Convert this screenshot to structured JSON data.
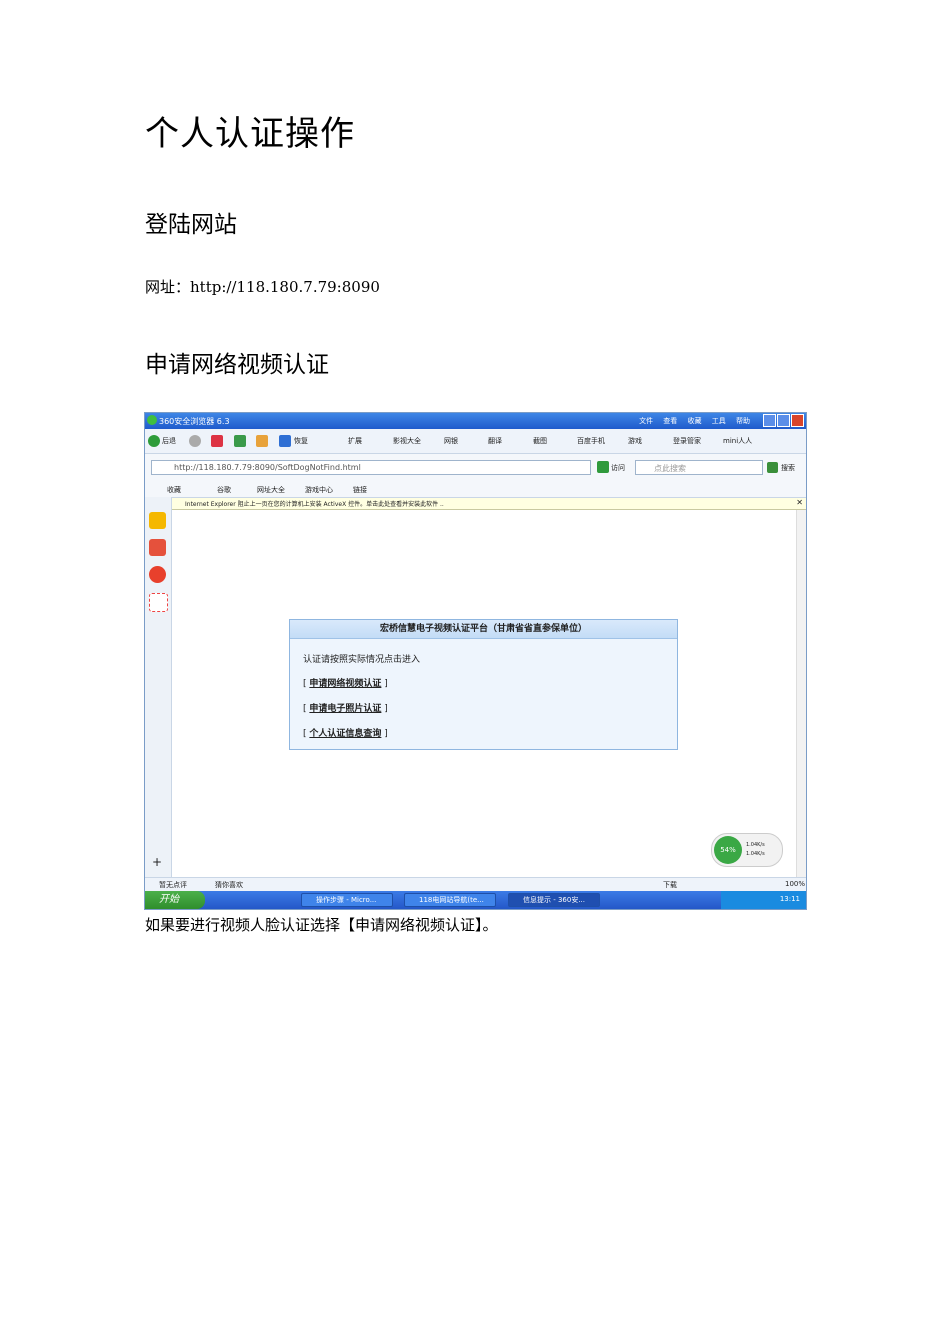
{
  "doc": {
    "title": "个人认证操作",
    "section1": "登陆网站",
    "url_line": "网址：http://118.180.7.79:8090",
    "section2": "申请网络视频认证",
    "caption": "如果要进行视频人脸认证选择【申请网络视频认证】。"
  },
  "browser": {
    "title": "360安全浏览器 6.3",
    "menus": [
      "文件",
      "查看",
      "收藏",
      "工具",
      "帮助"
    ],
    "toolbar": [
      "后退",
      "恢复",
      "扩展",
      "影视大全",
      "网银",
      "翻译",
      "截图",
      "百度手机",
      "游戏",
      "登录管家",
      "mini人人"
    ],
    "address_url": "http://118.180.7.79:8090/SoftDogNotFind.html",
    "go_label": "访问",
    "search_placeholder": "点此搜索",
    "search_button": "搜索",
    "favorites": [
      "收藏",
      "谷歌",
      "网址大全",
      "游戏中心",
      "链接"
    ],
    "infobar": "Internet Explorer 阻止上一页在您的计算机上安装 ActiveX 控件。单击此处查看并安装此软件 ..",
    "speed_percent": "54%",
    "speed_up": "1.04K/s",
    "speed_down": "1.04K/s",
    "status_left": "暂无点评",
    "status_mid": "猜你喜欢",
    "status_download": "下载",
    "status_zoom": "100%",
    "start_label": "开始",
    "tasks": [
      "操作步骤 - Micro...",
      "118电网站导航(te...",
      "信息提示 - 360安..."
    ],
    "clock": "13:11"
  },
  "panel": {
    "title": "宏桥信慧电子视频认证平台（甘肃省省直参保单位）",
    "intro": "认证请按照实际情况点击进入",
    "links": [
      "申请网络视频认证",
      "申请电子照片认证",
      "个人认证信息查询"
    ]
  }
}
